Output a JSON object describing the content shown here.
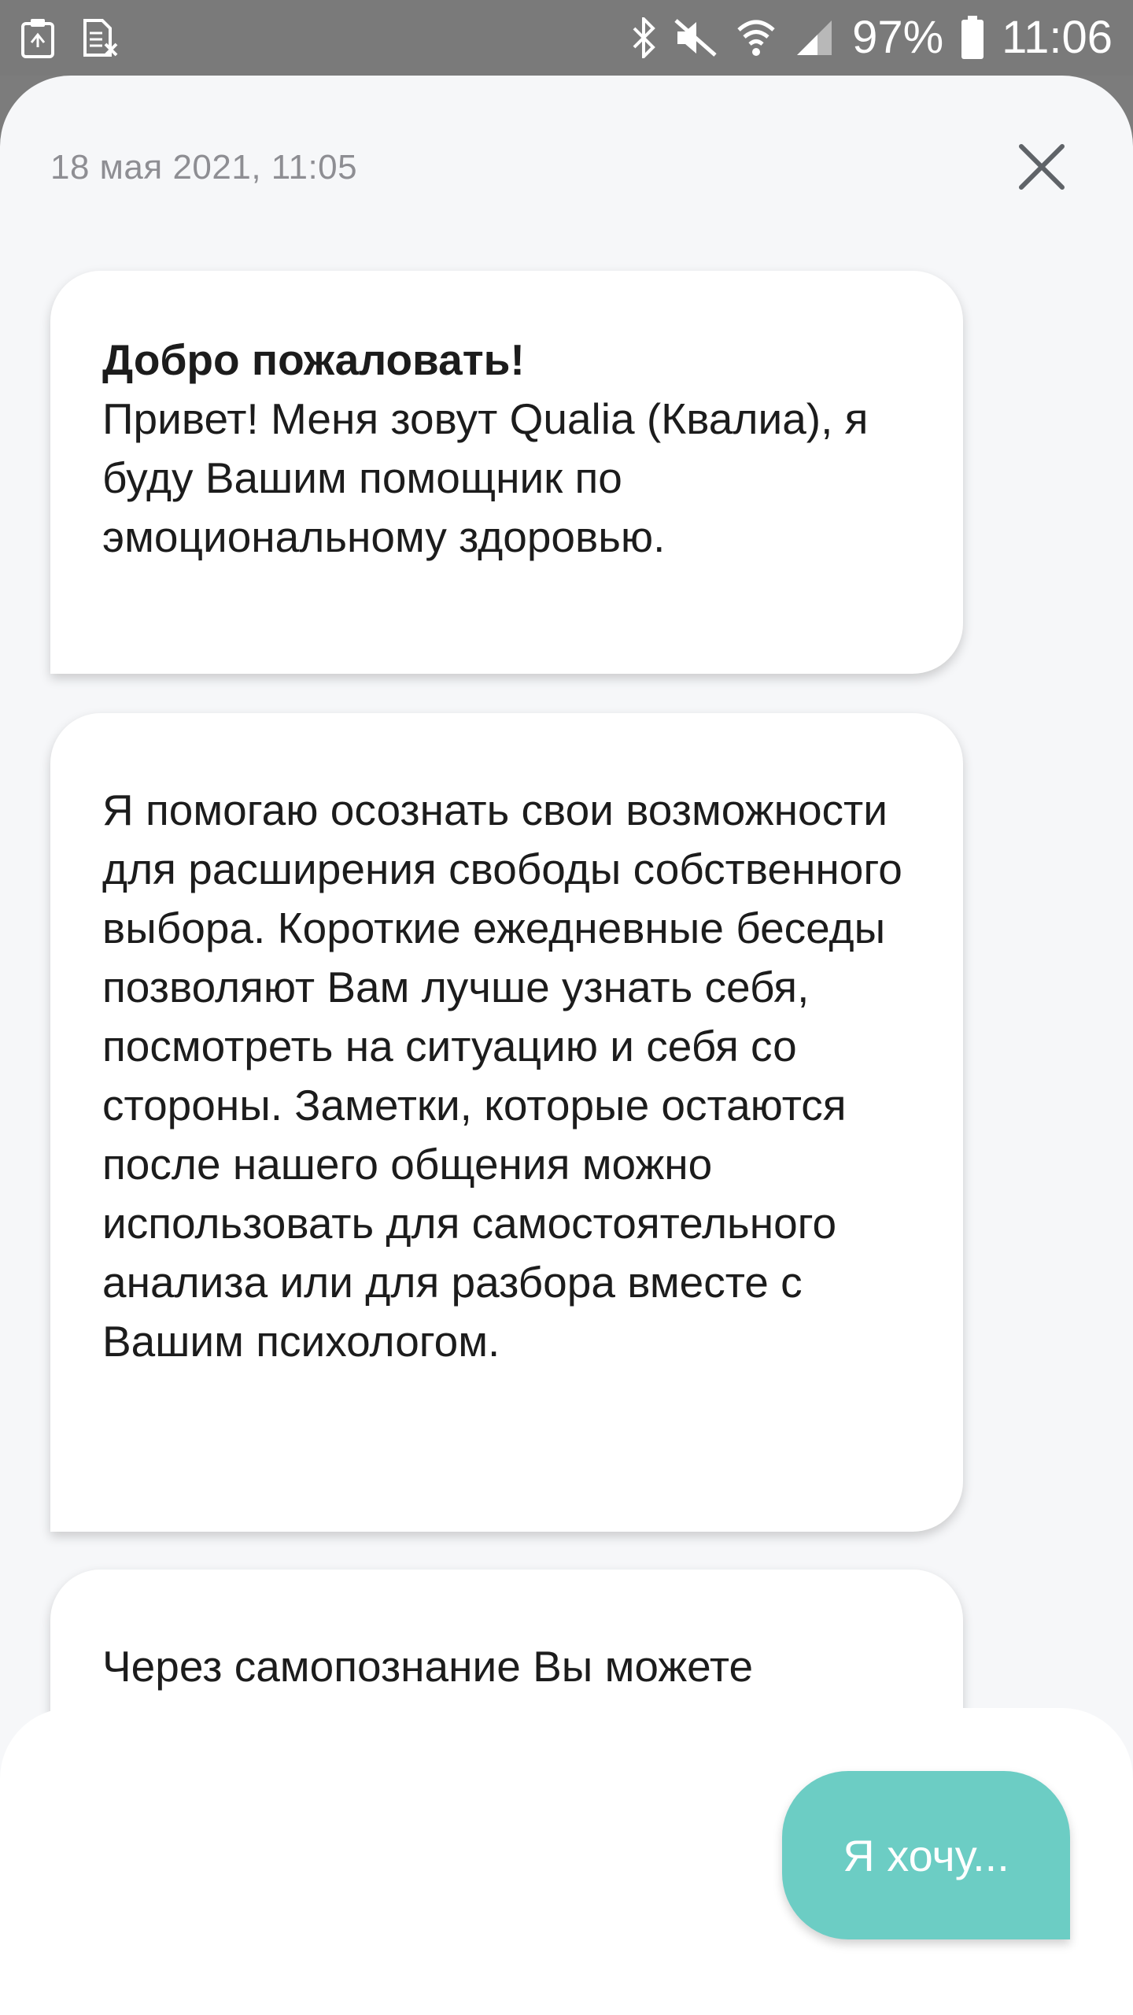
{
  "status_bar": {
    "left_icons": [
      "recycle-notification-icon",
      "sim-card-off-icon"
    ],
    "right_icons": [
      "bluetooth-icon",
      "mute-icon",
      "wifi-icon",
      "signal-icon",
      "battery-icon"
    ],
    "battery_percent": "97%",
    "time": "11:06"
  },
  "chat": {
    "timestamp": "18 мая 2021, 11:05",
    "close_icon": "close-icon",
    "messages": [
      {
        "title": "Добро пожаловать!",
        "text": "Привет! Меня зовут Qualia (Квалиа), я буду Вашим помощник по эмоциональному здоровью."
      },
      {
        "text": "Я помогаю осознать свои возможности для расширения свободы собственного выбора. Короткие ежедневные беседы позволяют Вам лучше узнать себя, посмотреть на ситуацию и себя со стороны. Заметки, которые остаются после нашего общения можно использовать для самостоятельного анализа или для разбора вместе с Вашим психологом."
      },
      {
        "text": "Через самопознание Вы можете"
      }
    ]
  },
  "reply": {
    "button_label": "Я хочу...",
    "accent_color": "#6ccdc4"
  }
}
